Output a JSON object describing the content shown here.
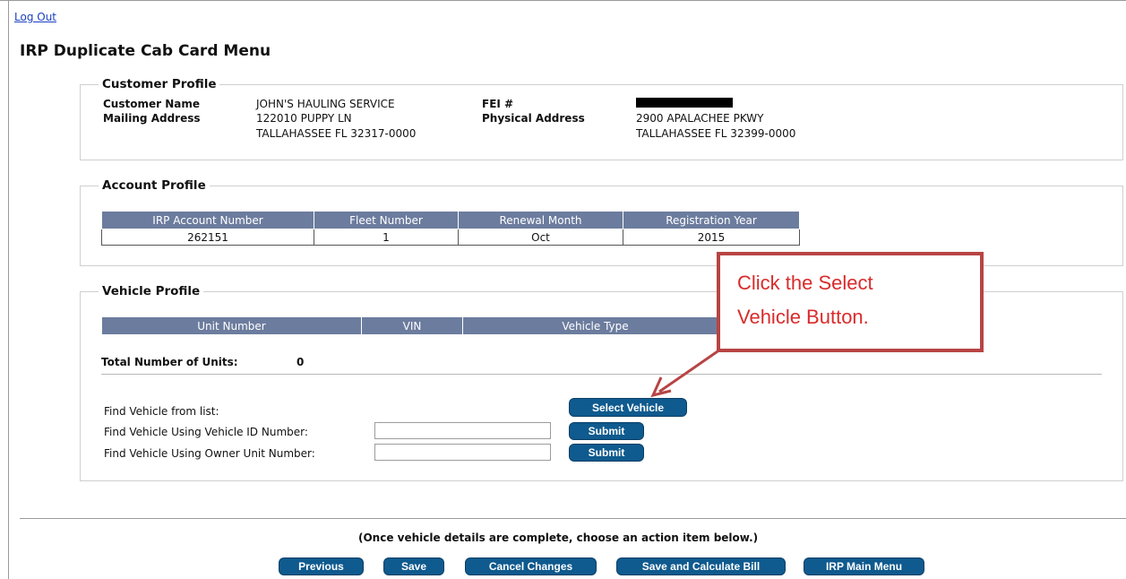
{
  "header": {
    "logout_label": "Log Out",
    "title": "IRP Duplicate Cab Card Menu"
  },
  "customer_profile": {
    "legend": "Customer Profile",
    "customer_name_label": "Customer Name",
    "customer_name": "JOHN'S HAULING SERVICE",
    "fei_label": "FEI #",
    "mailing_address_label": "Mailing Address",
    "mailing_line1": "122010 PUPPY LN",
    "mailing_line2": "TALLAHASSEE FL 32317-0000",
    "physical_address_label": "Physical Address",
    "physical_line1": "2900 APALACHEE PKWY",
    "physical_line2": "TALLAHASSEE FL 32399-0000"
  },
  "account_profile": {
    "legend": "Account Profile",
    "columns": [
      "IRP Account Number",
      "Fleet Number",
      "Renewal Month",
      "Registration Year"
    ],
    "row": [
      "262151",
      "1",
      "Oct",
      "2015"
    ]
  },
  "vehicle_profile": {
    "legend": "Vehicle Profile",
    "columns": [
      "Unit Number",
      "VIN",
      "Vehicle Type"
    ],
    "total_units_label": "Total Number of Units:",
    "total_units_value": "0",
    "find_from_list_label": "Find Vehicle from list:",
    "select_vehicle_button": "Select Vehicle",
    "find_by_vin_label": "Find Vehicle Using Vehicle ID Number:",
    "vin_input_value": "",
    "find_by_unit_label": "Find Vehicle Using Owner Unit Number:",
    "unit_input_value": "",
    "submit_label": "Submit"
  },
  "footer": {
    "instruction": "(Once vehicle details are complete, choose an action item below.)",
    "buttons": {
      "previous": "Previous",
      "save": "Save",
      "cancel": "Cancel Changes",
      "save_calc": "Save and Calculate Bill",
      "main_menu": "IRP Main Menu"
    }
  },
  "annotation": {
    "line1": "Click the Select",
    "line2": "Vehicle Button.",
    "color": "#d92b2b",
    "border_color": "#b84444"
  },
  "colors": {
    "button_bg": "#0f5a8e",
    "table_header_bg": "#6c7c9e",
    "link": "#1a3fbf"
  }
}
